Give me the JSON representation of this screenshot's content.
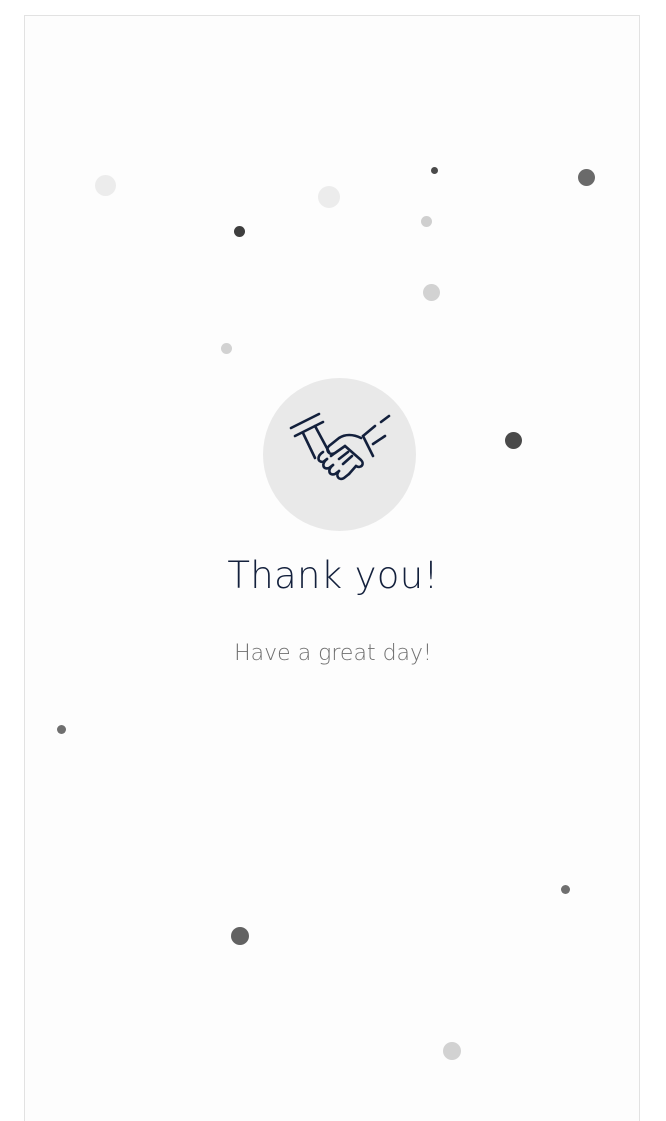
{
  "message": {
    "title": "Thank you!",
    "subtitle": "Have a great day!",
    "icon": "handshake-icon"
  },
  "colors": {
    "title": "#13203c",
    "subtitle": "#6f6f6f",
    "icon_background": "#e9e9e9",
    "icon_stroke": "#13203c",
    "confetti_dark": "#4a4a4a",
    "confetti_mid": "#7a7a7a",
    "confetti_light": "#d2d2d2",
    "confetti_faint": "#ececec"
  }
}
